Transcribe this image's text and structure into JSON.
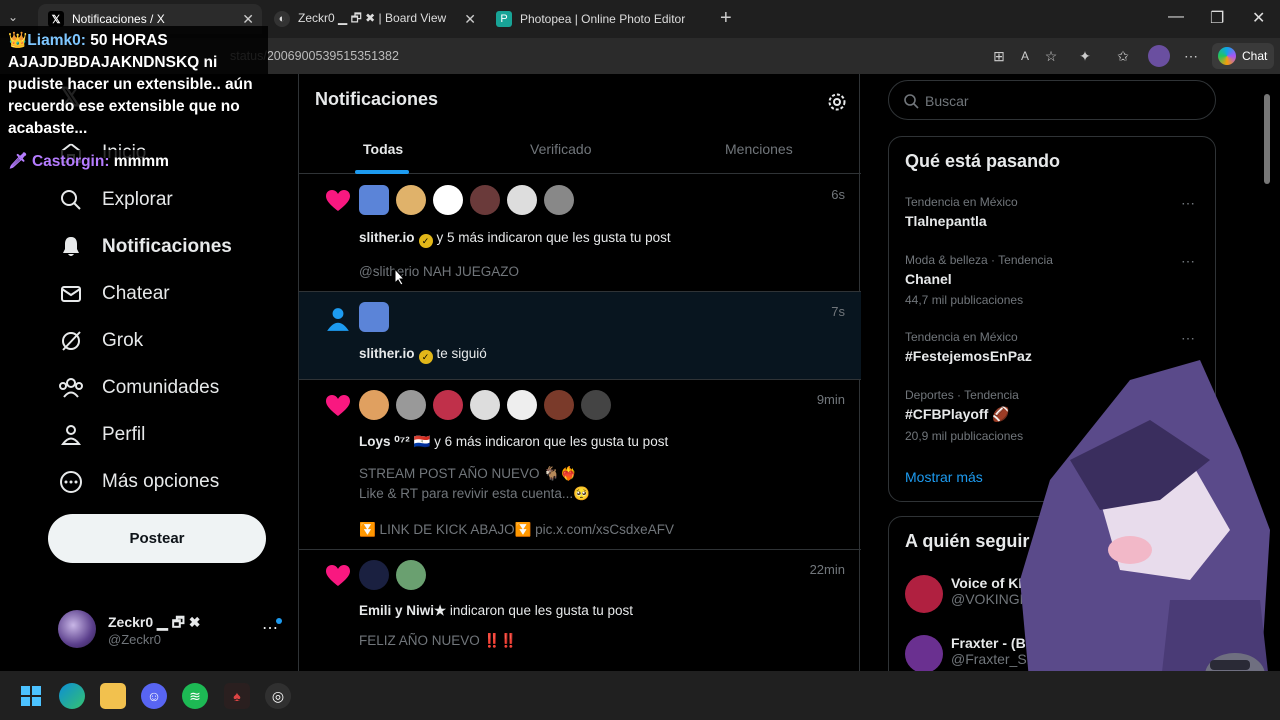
{
  "browser": {
    "tabs": [
      {
        "label": "Notificaciones / X",
        "icon": "x-logo-icon"
      },
      {
        "label": "Zeckr0 ▁ 🗗 ✖ | Board View",
        "icon": "site-icon"
      },
      {
        "label": "Photopea | Online Photo Editor",
        "icon": "photopea-icon"
      }
    ],
    "url": "status/2006900539515351382",
    "chat_label": "Chat"
  },
  "nav": {
    "items": [
      {
        "label": "Inicio",
        "icon": "home-icon"
      },
      {
        "label": "Explorar",
        "icon": "search-icon"
      },
      {
        "label": "Notificaciones",
        "icon": "bell-icon"
      },
      {
        "label": "Chatear",
        "icon": "mail-icon"
      },
      {
        "label": "Grok",
        "icon": "grok-icon"
      },
      {
        "label": "Comunidades",
        "icon": "communities-icon"
      },
      {
        "label": "Perfil",
        "icon": "person-icon"
      },
      {
        "label": "Más opciones",
        "icon": "more-circle-icon"
      }
    ],
    "post_label": "Postear",
    "profile_name": "Zeckr0 ▁ 🗗 ✖",
    "profile_handle": "@Zeckr0"
  },
  "feed": {
    "title": "Notificaciones",
    "tabs": [
      "Todas",
      "Verificado",
      "Menciones"
    ],
    "notifications": [
      {
        "time": "6s",
        "user": "slither.io",
        "action": "y 5 más indicaron que les gusta tu post",
        "sub": "@slitherio NAH JUEGAZO"
      },
      {
        "time": "7s",
        "user": "slither.io",
        "action": "te siguió"
      },
      {
        "time": "9min",
        "user": "Loys ⁰⁷² 🇵🇾",
        "action": "y 6 más indicaron que les gusta tu post",
        "sub1": "STREAM POST AÑO NUEVO 🐐❤️‍🔥",
        "sub2": "Like & RT para revivir esta cuenta...🥺",
        "sub3": "⏬ LINK DE KICK ABAJO⏬ pic.x.com/xsCsdxeAFV"
      },
      {
        "time": "22min",
        "user": "Emili y Niwi★",
        "action": "indicaron que les gusta tu post",
        "sub": "FELIZ AÑO NUEVO ‼️‼️"
      }
    ]
  },
  "sidebar": {
    "search_placeholder": "Buscar",
    "trends_title": "Qué está pasando",
    "trends": [
      {
        "category": "Tendencia en México",
        "title": "Tlalnepantla",
        "posts": ""
      },
      {
        "category": "Moda & belleza · Tendencia",
        "title": "Chanel",
        "posts": "44,7 mil publicaciones"
      },
      {
        "category": "Tendencia en México",
        "title": "#FestejemosEnPaz",
        "posts": ""
      },
      {
        "category": "Deportes · Tendencia",
        "title": "#CFBPlayoff 🏈",
        "posts": "20,9 mil publicaciones"
      }
    ],
    "show_more": "Mostrar más",
    "who_title": "A quién seguir",
    "who": [
      {
        "name": "Voice of KINGF0X | Vo",
        "handle": "@VOKINGF0X"
      },
      {
        "name": "Fraxter - (Bobi & Kl",
        "handle": "@Fraxter_SM"
      }
    ]
  },
  "chat_overlay": {
    "user1": "👑Liamk0:",
    "msg1": "50 HORAS AJAJDJBDAJAKNDNSKQ ni pudiste hacer un extensible.. aún recuerdo ese extensible que no acabaste...",
    "user2": "🗡 Castorgin:",
    "msg2": "mmmm"
  }
}
